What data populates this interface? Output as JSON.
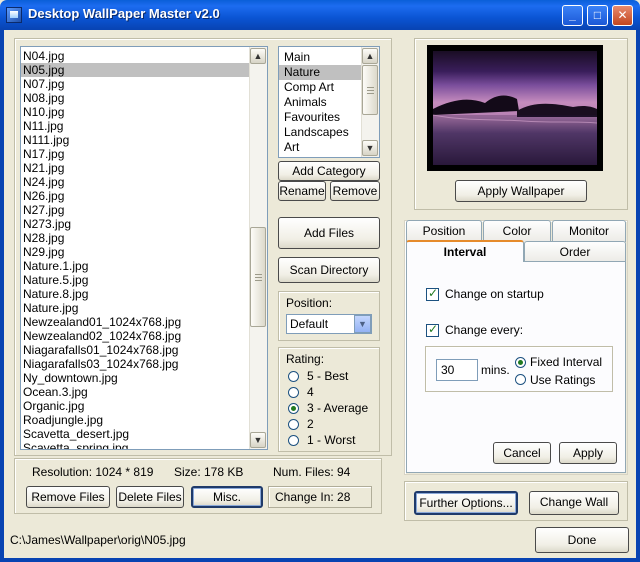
{
  "window": {
    "title": "Desktop WallPaper Master v2.0",
    "minimize": "_",
    "maximize": "□",
    "close": "✕"
  },
  "files": {
    "items": [
      "N04.jpg",
      "N05.jpg",
      "N07.jpg",
      "N08.jpg",
      "N10.jpg",
      "N11.jpg",
      "N111.jpg",
      "N17.jpg",
      "N21.jpg",
      "N24.jpg",
      "N26.jpg",
      "N27.jpg",
      "N273.jpg",
      "N28.jpg",
      "N29.jpg",
      "Nature.1.jpg",
      "Nature.5.jpg",
      "Nature.8.jpg",
      "Nature.jpg",
      "Newzealand01_1024x768.jpg",
      "Newzealand02_1024x768.jpg",
      "Niagarafalls01_1024x768.jpg",
      "Niagarafalls03_1024x768.jpg",
      "Ny_downtown.jpg",
      "Ocean.3.jpg",
      "Organic.jpg",
      "Roadjungle.jpg",
      "Scavetta_desert.jpg",
      "Scavetta_spring.jpg"
    ],
    "selected_index": 1
  },
  "categories": {
    "items": [
      "Main",
      "Nature",
      "Comp Art",
      "Animals",
      "Favourites",
      "Landscapes",
      "Art"
    ],
    "selected_index": 1
  },
  "buttons": {
    "add_category": "Add Category",
    "rename": "Rename",
    "remove": "Remove",
    "add_files": "Add Files",
    "scan_directory": "Scan Directory",
    "apply_wallpaper": "Apply Wallpaper",
    "remove_files": "Remove Files",
    "delete_files": "Delete Files",
    "misc": "Misc.",
    "cancel": "Cancel",
    "apply": "Apply",
    "further_options": "Further Options...",
    "change_wall": "Change Wall",
    "done": "Done"
  },
  "position": {
    "label": "Position:",
    "value": "Default"
  },
  "rating": {
    "label": "Rating:",
    "options": [
      "5 - Best",
      "4",
      "3 - Average",
      "2",
      "1 - Worst"
    ],
    "selected_index": 2
  },
  "status": {
    "resolution": "Resolution: 1024 * 819",
    "size": "Size: 178 KB",
    "num_files": "Num. Files: 94",
    "change_in": "Change In: 28"
  },
  "tabs": {
    "row_back": [
      "Position",
      "Color",
      "Monitor"
    ],
    "row_front": [
      "Interval",
      "Order"
    ],
    "active": "Interval"
  },
  "interval": {
    "change_on_startup": "Change on startup",
    "change_on_startup_checked": true,
    "change_every": "Change every:",
    "change_every_checked": true,
    "minutes_value": "30",
    "minutes_unit": "mins.",
    "fixed_interval": "Fixed Interval",
    "use_ratings": "Use Ratings",
    "mode_selected": "Fixed Interval"
  },
  "path": "C:\\James\\Wallpaper\\orig\\N05.jpg",
  "colors": {
    "titlebar": "#0a54d3",
    "window_bg": "#ece9d8",
    "selection": "#c0c0c0",
    "radio_dot": "#217a21"
  }
}
